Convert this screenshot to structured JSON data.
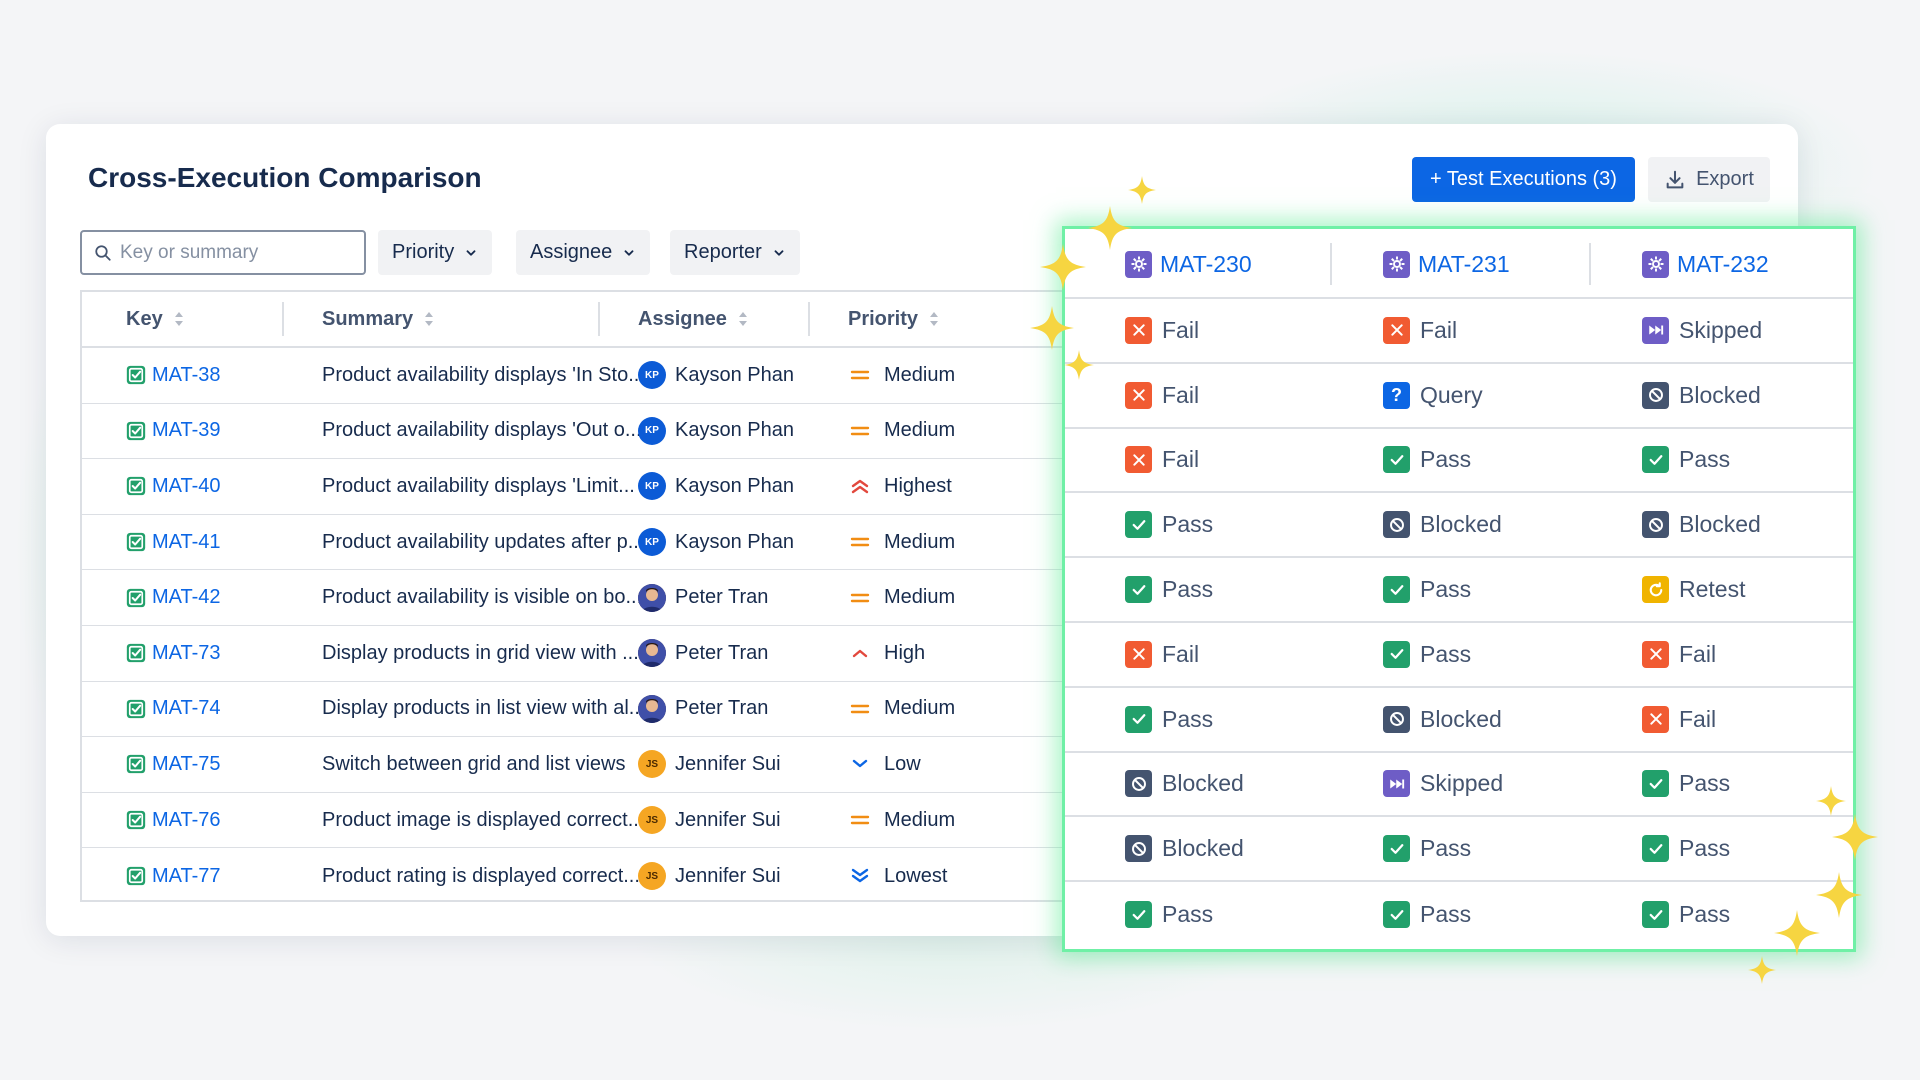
{
  "page": {
    "title": "Cross-Execution Comparison",
    "add_button_label": "+ Test Executions (3)",
    "export_label": "Export"
  },
  "filters": {
    "search_placeholder": "Key or summary",
    "priority_label": "Priority",
    "assignee_label": "Assignee",
    "reporter_label": "Reporter"
  },
  "table": {
    "columns": [
      "Key",
      "Summary",
      "Assignee",
      "Priority"
    ],
    "rows": [
      {
        "key": "MAT-38",
        "summary": "Product availability displays 'In Sto...",
        "assignee": "Kayson Phan",
        "initials": "KP",
        "avatar": "blue",
        "priority": "Medium",
        "priority_icon": "medium"
      },
      {
        "key": "MAT-39",
        "summary": "Product availability displays 'Out o...",
        "assignee": "Kayson Phan",
        "initials": "KP",
        "avatar": "blue",
        "priority": "Medium",
        "priority_icon": "medium"
      },
      {
        "key": "MAT-40",
        "summary": "Product availability displays 'Limit...",
        "assignee": "Kayson Phan",
        "initials": "KP",
        "avatar": "blue",
        "priority": "Highest",
        "priority_icon": "highest"
      },
      {
        "key": "MAT-41",
        "summary": "Product availability updates after p...",
        "assignee": "Kayson Phan",
        "initials": "KP",
        "avatar": "blue",
        "priority": "Medium",
        "priority_icon": "medium"
      },
      {
        "key": "MAT-42",
        "summary": "Product availability is visible on bo...",
        "assignee": "Peter Tran",
        "initials": "",
        "avatar": "photo",
        "priority": "Medium",
        "priority_icon": "medium"
      },
      {
        "key": "MAT-73",
        "summary": "Display products in grid view with ...",
        "assignee": "Peter Tran",
        "initials": "",
        "avatar": "photo",
        "priority": "High",
        "priority_icon": "high"
      },
      {
        "key": "MAT-74",
        "summary": "Display products in list view with al...",
        "assignee": "Peter Tran",
        "initials": "",
        "avatar": "photo",
        "priority": "Medium",
        "priority_icon": "medium"
      },
      {
        "key": "MAT-75",
        "summary": "Switch between grid and list views",
        "assignee": "Jennifer Sui",
        "initials": "JS",
        "avatar": "orange",
        "priority": "Low",
        "priority_icon": "low"
      },
      {
        "key": "MAT-76",
        "summary": "Product image is displayed correct...",
        "assignee": "Jennifer Sui",
        "initials": "JS",
        "avatar": "orange",
        "priority": "Medium",
        "priority_icon": "medium"
      },
      {
        "key": "MAT-77",
        "summary": "Product rating is displayed correct...",
        "assignee": "Jennifer Sui",
        "initials": "JS",
        "avatar": "orange",
        "priority": "Lowest",
        "priority_icon": "lowest"
      }
    ]
  },
  "comparison": {
    "executions": [
      "MAT-230",
      "MAT-231",
      "MAT-232"
    ],
    "rows": [
      [
        "Fail",
        "Fail",
        "Skipped"
      ],
      [
        "Fail",
        "Query",
        "Blocked"
      ],
      [
        "Fail",
        "Pass",
        "Pass"
      ],
      [
        "Pass",
        "Blocked",
        "Blocked"
      ],
      [
        "Pass",
        "Pass",
        "Retest"
      ],
      [
        "Fail",
        "Pass",
        "Fail"
      ],
      [
        "Pass",
        "Blocked",
        "Fail"
      ],
      [
        "Blocked",
        "Skipped",
        "Pass"
      ],
      [
        "Blocked",
        "Pass",
        "Pass"
      ],
      [
        "Pass",
        "Pass",
        "Pass"
      ]
    ]
  },
  "colors": {
    "accent": "#0c66e4",
    "pass": "#22a06b",
    "fail": "#f15b32",
    "blocked": "#44546f",
    "skipped": "#6e5dc6",
    "query": "#0c66e4",
    "retest": "#f0b400",
    "highlight": "#6ff0a6"
  }
}
